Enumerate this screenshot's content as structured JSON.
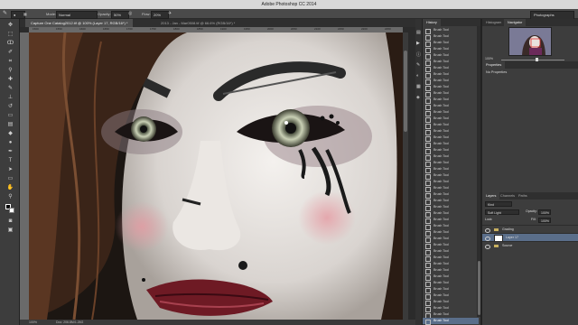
{
  "menubar": {
    "title": "Adobe Photoshop CC 2014",
    "workspace": "Photographs"
  },
  "options": {
    "mode_label": "Mode:",
    "mode_value": "Normal",
    "opacity_label": "Opacity:",
    "opacity_value": "50%",
    "flow_label": "Flow:",
    "flow_value": "20%"
  },
  "tabs": [
    {
      "label": "Capture One Catalog2012.tif @ 100% (Layer 17, RGB/16*) *"
    },
    {
      "label": "2013 - Jan - Mar0508.tif @ 66.6% (RGB/16*) *"
    }
  ],
  "ruler": [
    "1500",
    "1550",
    "1600",
    "1650",
    "1700",
    "1750",
    "1800",
    "1850",
    "1900",
    "1950",
    "2000",
    "2050",
    "2100",
    "2150",
    "2200",
    "2250"
  ],
  "status": {
    "zoom": "100%",
    "doc": "Doc: 206.8M/1.26G"
  },
  "history": {
    "tab": "History",
    "items": [
      "Brush Tool",
      "Brush Tool",
      "Brush Tool",
      "Brush Tool",
      "Brush Tool",
      "Brush Tool",
      "Brush Tool",
      "Brush Tool",
      "Brush Tool",
      "Brush Tool",
      "Brush Tool",
      "Brush Tool",
      "Brush Tool",
      "Brush Tool",
      "Brush Tool",
      "Brush Tool",
      "Brush Tool",
      "Brush Tool",
      "Brush Tool",
      "Brush Tool",
      "Brush Tool",
      "Brush Tool",
      "Brush Tool",
      "Brush Tool",
      "Brush Tool",
      "Brush Tool",
      "Brush Tool",
      "Brush Tool",
      "Brush Tool",
      "Brush Tool",
      "Brush Tool",
      "Brush Tool",
      "Brush Tool",
      "Brush Tool",
      "Brush Tool",
      "Brush Tool",
      "Brush Tool",
      "Brush Tool",
      "Brush Tool",
      "Brush Tool",
      "Brush Tool",
      "Brush Tool",
      "Brush Tool",
      "Brush Tool",
      "Brush Tool",
      "Brush Tool",
      "Brush Tool"
    ]
  },
  "navigator": {
    "tabs": [
      "Histogram",
      "Navigator"
    ],
    "zoom": "100%"
  },
  "properties": {
    "tab": "Properties",
    "text": "No Properties"
  },
  "layers": {
    "tabs": [
      "Layers",
      "Channels",
      "Paths"
    ],
    "kind": "Kind",
    "blend": "Soft Light",
    "opacity_label": "Opacity:",
    "opacity_value": "100%",
    "lock_label": "Lock:",
    "fill_label": "Fill:",
    "fill_value": "100%",
    "rows": [
      {
        "name": "Grading",
        "type": "group"
      },
      {
        "name": "Layer 17",
        "type": "layer"
      },
      {
        "name": "Source",
        "type": "group"
      }
    ]
  },
  "colors": {
    "accent": "#5a6e8a",
    "panel": "#3d3d3d"
  }
}
